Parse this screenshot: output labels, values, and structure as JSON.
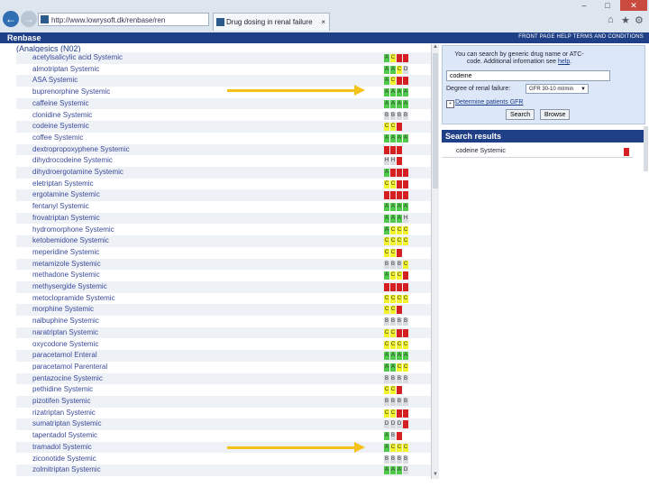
{
  "browser": {
    "address": "http://www.lowrysoft.dk/renbase/ren",
    "tab_title": "Drug dosing in renal failure",
    "tab_close": "×",
    "back": "←",
    "forward": "→",
    "window_buttons": [
      "–",
      "□",
      "✕"
    ],
    "toolbar_icons": [
      "⌂",
      "★",
      "⚙"
    ]
  },
  "app": {
    "brand": "Renbase",
    "top_links": "FRONT PAGE   HELP   TERMS AND CONDITIONS"
  },
  "list": {
    "category": "(Analgesics (N02)",
    "rows": [
      {
        "name": "acetylsalicylic acid Systemic",
        "cells": [
          {
            "c": "green",
            "t": "A"
          },
          {
            "c": "yellow",
            "t": "C"
          },
          {
            "c": "red",
            "t": ""
          },
          {
            "c": "red",
            "t": ""
          }
        ]
      },
      {
        "name": "almotriptan Systemic",
        "cells": [
          {
            "c": "green",
            "t": "A"
          },
          {
            "c": "green",
            "t": "A"
          },
          {
            "c": "yellow",
            "t": "C"
          },
          {
            "c": "grey",
            "t": "D"
          }
        ]
      },
      {
        "name": "ASA Systemic",
        "cells": [
          {
            "c": "green",
            "t": "A"
          },
          {
            "c": "yellow",
            "t": "C"
          },
          {
            "c": "red",
            "t": ""
          },
          {
            "c": "red",
            "t": ""
          }
        ]
      },
      {
        "name": "buprenorphine Systemic",
        "cells": [
          {
            "c": "green",
            "t": "A"
          },
          {
            "c": "green",
            "t": "A"
          },
          {
            "c": "green",
            "t": "A"
          },
          {
            "c": "green",
            "t": "A"
          }
        ]
      },
      {
        "name": "caffeine Systemic",
        "cells": [
          {
            "c": "green",
            "t": "A"
          },
          {
            "c": "green",
            "t": "A"
          },
          {
            "c": "green",
            "t": "A"
          },
          {
            "c": "green",
            "t": "A"
          }
        ]
      },
      {
        "name": "clonidine Systemic",
        "cells": [
          {
            "c": "grey",
            "t": "B"
          },
          {
            "c": "grey",
            "t": "B"
          },
          {
            "c": "grey",
            "t": "B"
          },
          {
            "c": "grey",
            "t": "B"
          }
        ]
      },
      {
        "name": "codeine Systemic",
        "cells": [
          {
            "c": "yellow",
            "t": "C"
          },
          {
            "c": "yellow",
            "t": "C"
          },
          {
            "c": "red",
            "t": ""
          }
        ]
      },
      {
        "name": "coffee Systemic",
        "cells": [
          {
            "c": "green",
            "t": "A"
          },
          {
            "c": "green",
            "t": "A"
          },
          {
            "c": "green",
            "t": "A"
          },
          {
            "c": "green",
            "t": "A"
          }
        ]
      },
      {
        "name": "dextropropoxyphene Systemic",
        "cells": [
          {
            "c": "red",
            "t": ""
          },
          {
            "c": "red",
            "t": ""
          },
          {
            "c": "red",
            "t": ""
          }
        ]
      },
      {
        "name": "dihydrocodeine Systemic",
        "cells": [
          {
            "c": "grey",
            "t": "H"
          },
          {
            "c": "grey",
            "t": "H"
          },
          {
            "c": "red",
            "t": ""
          }
        ]
      },
      {
        "name": "dihydroergotamine Systemic",
        "cells": [
          {
            "c": "green",
            "t": "A"
          },
          {
            "c": "red",
            "t": ""
          },
          {
            "c": "red",
            "t": ""
          },
          {
            "c": "red",
            "t": ""
          }
        ]
      },
      {
        "name": "eletriptan Systemic",
        "cells": [
          {
            "c": "yellow",
            "t": "C"
          },
          {
            "c": "yellow",
            "t": "C"
          },
          {
            "c": "red",
            "t": ""
          },
          {
            "c": "red",
            "t": ""
          }
        ]
      },
      {
        "name": "ergotamine Systemic",
        "cells": [
          {
            "c": "red",
            "t": ""
          },
          {
            "c": "red",
            "t": ""
          },
          {
            "c": "red",
            "t": ""
          },
          {
            "c": "red",
            "t": ""
          }
        ]
      },
      {
        "name": "fentanyl Systemic",
        "cells": [
          {
            "c": "green",
            "t": "A"
          },
          {
            "c": "green",
            "t": "A"
          },
          {
            "c": "green",
            "t": "A"
          },
          {
            "c": "green",
            "t": "A"
          }
        ]
      },
      {
        "name": "frovatriptan Systemic",
        "cells": [
          {
            "c": "green",
            "t": "A"
          },
          {
            "c": "green",
            "t": "A"
          },
          {
            "c": "green",
            "t": "A"
          },
          {
            "c": "grey",
            "t": "H"
          }
        ]
      },
      {
        "name": "hydromorphone Systemic",
        "cells": [
          {
            "c": "green",
            "t": "A"
          },
          {
            "c": "yellow",
            "t": "C"
          },
          {
            "c": "yellow",
            "t": "C"
          },
          {
            "c": "yellow",
            "t": "C"
          }
        ]
      },
      {
        "name": "ketobemidone Systemic",
        "cells": [
          {
            "c": "yellow",
            "t": "C"
          },
          {
            "c": "yellow",
            "t": "C"
          },
          {
            "c": "yellow",
            "t": "C"
          },
          {
            "c": "yellow",
            "t": "C"
          }
        ]
      },
      {
        "name": "meperidine Systemic",
        "cells": [
          {
            "c": "yellow",
            "t": "C"
          },
          {
            "c": "yellow",
            "t": "C"
          },
          {
            "c": "red",
            "t": ""
          }
        ]
      },
      {
        "name": "metamizole Systemic",
        "cells": [
          {
            "c": "grey",
            "t": "B"
          },
          {
            "c": "grey",
            "t": "B"
          },
          {
            "c": "grey",
            "t": "B"
          },
          {
            "c": "yellow",
            "t": "C"
          }
        ]
      },
      {
        "name": "methadone Systemic",
        "cells": [
          {
            "c": "green",
            "t": "A"
          },
          {
            "c": "yellow",
            "t": "C"
          },
          {
            "c": "yellow",
            "t": "C"
          },
          {
            "c": "red",
            "t": ""
          }
        ]
      },
      {
        "name": "methysergide Systemic",
        "cells": [
          {
            "c": "red",
            "t": ""
          },
          {
            "c": "red",
            "t": ""
          },
          {
            "c": "red",
            "t": ""
          },
          {
            "c": "red",
            "t": ""
          }
        ]
      },
      {
        "name": "metoclopramide Systemic",
        "cells": [
          {
            "c": "yellow",
            "t": "C"
          },
          {
            "c": "yellow",
            "t": "C"
          },
          {
            "c": "yellow",
            "t": "C"
          },
          {
            "c": "yellow",
            "t": "C"
          }
        ]
      },
      {
        "name": "morphine Systemic",
        "cells": [
          {
            "c": "yellow",
            "t": "C"
          },
          {
            "c": "yellow",
            "t": "C"
          },
          {
            "c": "red",
            "t": ""
          }
        ]
      },
      {
        "name": "nalbuphine Systemic",
        "cells": [
          {
            "c": "grey",
            "t": "B"
          },
          {
            "c": "grey",
            "t": "B"
          },
          {
            "c": "grey",
            "t": "B"
          },
          {
            "c": "grey",
            "t": "B"
          }
        ]
      },
      {
        "name": "naratriptan Systemic",
        "cells": [
          {
            "c": "yellow",
            "t": "C"
          },
          {
            "c": "yellow",
            "t": "C"
          },
          {
            "c": "red",
            "t": ""
          },
          {
            "c": "red",
            "t": ""
          }
        ]
      },
      {
        "name": "oxycodone Systemic",
        "cells": [
          {
            "c": "yellow",
            "t": "C"
          },
          {
            "c": "yellow",
            "t": "C"
          },
          {
            "c": "yellow",
            "t": "C"
          },
          {
            "c": "yellow",
            "t": "C"
          }
        ]
      },
      {
        "name": "paracetamol Enteral",
        "cells": [
          {
            "c": "green",
            "t": "A"
          },
          {
            "c": "green",
            "t": "A"
          },
          {
            "c": "green",
            "t": "A"
          },
          {
            "c": "green",
            "t": "A"
          }
        ]
      },
      {
        "name": "paracetamol Parenteral",
        "cells": [
          {
            "c": "green",
            "t": "A"
          },
          {
            "c": "green",
            "t": "A"
          },
          {
            "c": "yellow",
            "t": "C"
          },
          {
            "c": "yellow",
            "t": "C"
          }
        ]
      },
      {
        "name": "pentazocine Systemic",
        "cells": [
          {
            "c": "grey",
            "t": "B"
          },
          {
            "c": "grey",
            "t": "B"
          },
          {
            "c": "grey",
            "t": "B"
          },
          {
            "c": "grey",
            "t": "B"
          }
        ]
      },
      {
        "name": "pethidine Systemic",
        "cells": [
          {
            "c": "yellow",
            "t": "C"
          },
          {
            "c": "yellow",
            "t": "C"
          },
          {
            "c": "red",
            "t": ""
          }
        ]
      },
      {
        "name": "pizotifen Systemic",
        "cells": [
          {
            "c": "grey",
            "t": "B"
          },
          {
            "c": "grey",
            "t": "B"
          },
          {
            "c": "grey",
            "t": "B"
          },
          {
            "c": "grey",
            "t": "B"
          }
        ]
      },
      {
        "name": "rizatriptan Systemic",
        "cells": [
          {
            "c": "yellow",
            "t": "C"
          },
          {
            "c": "yellow",
            "t": "C"
          },
          {
            "c": "red",
            "t": ""
          },
          {
            "c": "red",
            "t": ""
          }
        ]
      },
      {
        "name": "sumatriptan Systemic",
        "cells": [
          {
            "c": "grey",
            "t": "D"
          },
          {
            "c": "grey",
            "t": "D"
          },
          {
            "c": "grey",
            "t": "D"
          },
          {
            "c": "red",
            "t": ""
          }
        ]
      },
      {
        "name": "tapentadol Systemic",
        "cells": [
          {
            "c": "green",
            "t": "A"
          },
          {
            "c": "grey",
            "t": "B"
          },
          {
            "c": "red",
            "t": ""
          }
        ]
      },
      {
        "name": "tramadol Systemic",
        "cells": [
          {
            "c": "green",
            "t": "A"
          },
          {
            "c": "yellow",
            "t": "C"
          },
          {
            "c": "yellow",
            "t": "C"
          },
          {
            "c": "yellow",
            "t": "C"
          }
        ]
      },
      {
        "name": "ziconotide Systemic",
        "cells": [
          {
            "c": "grey",
            "t": "B"
          },
          {
            "c": "grey",
            "t": "B"
          },
          {
            "c": "grey",
            "t": "B"
          },
          {
            "c": "grey",
            "t": "B"
          }
        ]
      },
      {
        "name": "zolmitriptan Systemic",
        "cells": [
          {
            "c": "green",
            "t": "A"
          },
          {
            "c": "green",
            "t": "A"
          },
          {
            "c": "green",
            "t": "A"
          },
          {
            "c": "grey",
            "t": "D"
          }
        ]
      }
    ]
  },
  "search": {
    "help_text": "You can search by generic drug name or ATC-code. Additional information see",
    "help_link": "help",
    "query": "codeine",
    "renal_label": "Degree of renal failure:",
    "renal_value": "GFR 30-10 ml/min",
    "patients_check": "+",
    "patients_link": "Determine patients GFR",
    "search_button": "Search",
    "browse_button": "Browse"
  },
  "results": {
    "header": "Search results",
    "items": [
      {
        "name": "codeine Systemic"
      }
    ]
  },
  "colors": {
    "accent": "#1f3f86",
    "red": "#d42020",
    "green": "#4fca4a",
    "yellow": "#f2f22a",
    "arrow": "#f5c21a"
  }
}
